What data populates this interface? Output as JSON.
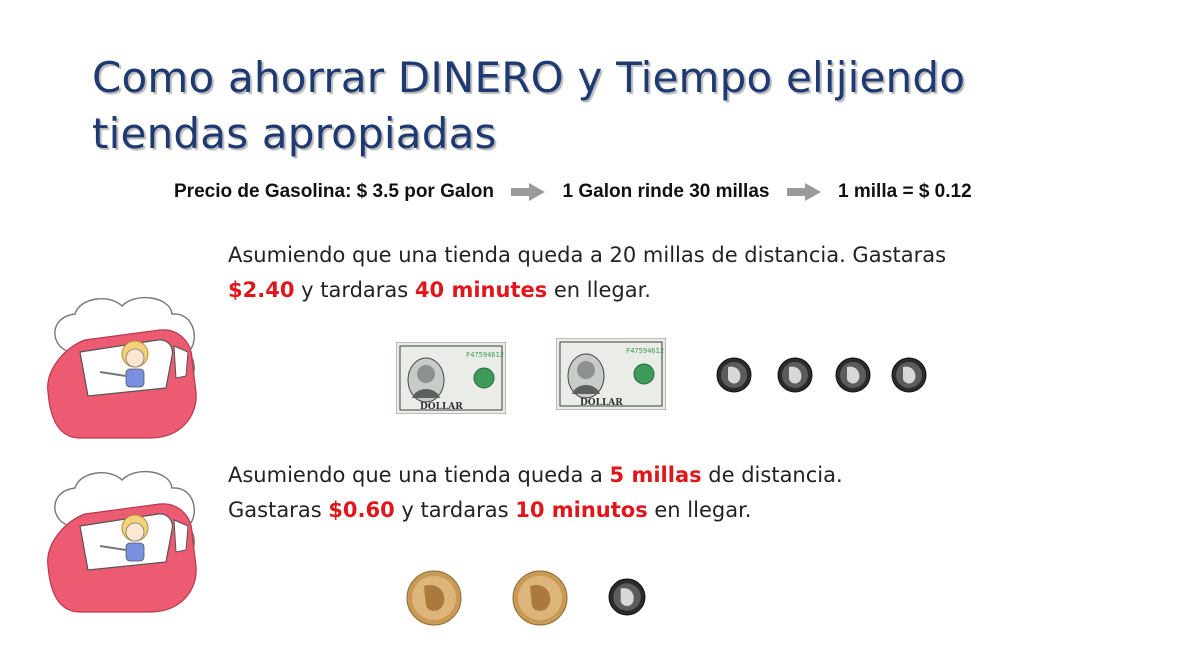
{
  "slide": {
    "title": "Como ahorrar DINERO y Tiempo elijiendo tiendas apropiadas",
    "gas": {
      "part1": "Precio de Gasolina: $ 3.5 por Galon",
      "part2": "1 Galon rinde 30 millas",
      "part3": "1 milla = $ 0.12"
    },
    "scenario1": {
      "text_a": "Asumiendo que una tienda queda a 20 millas de distancia. Gastaras ",
      "cost": "$2.40",
      "text_b": " y tardaras ",
      "time": "40 minutes",
      "text_c": " en llegar."
    },
    "scenario2": {
      "text_a": "Asumiendo que una tienda queda a ",
      "distance": "5 millas",
      "text_b": " de distancia. Gastaras ",
      "cost": "$0.60",
      "text_c": " y tardaras ",
      "time": "10 minutos",
      "text_d": " en llegar."
    },
    "money1": {
      "bills": 2,
      "dimes": 4,
      "bill_text": "DOLLAR",
      "bill_serial": "F47594612"
    },
    "money2": {
      "quarters": 2,
      "dimes": 1
    },
    "colors": {
      "title": "#1f3a72",
      "highlight": "#e0161b",
      "car": "#ec5b72",
      "arrow": "#9a9a9a",
      "quarter": "#c99a55",
      "dime": "#2b2b2b"
    },
    "icons": [
      "thought-cloud-car-icon",
      "arrow-right-icon",
      "dollar-bill-icon",
      "quarter-coin-icon",
      "dime-coin-icon"
    ]
  }
}
